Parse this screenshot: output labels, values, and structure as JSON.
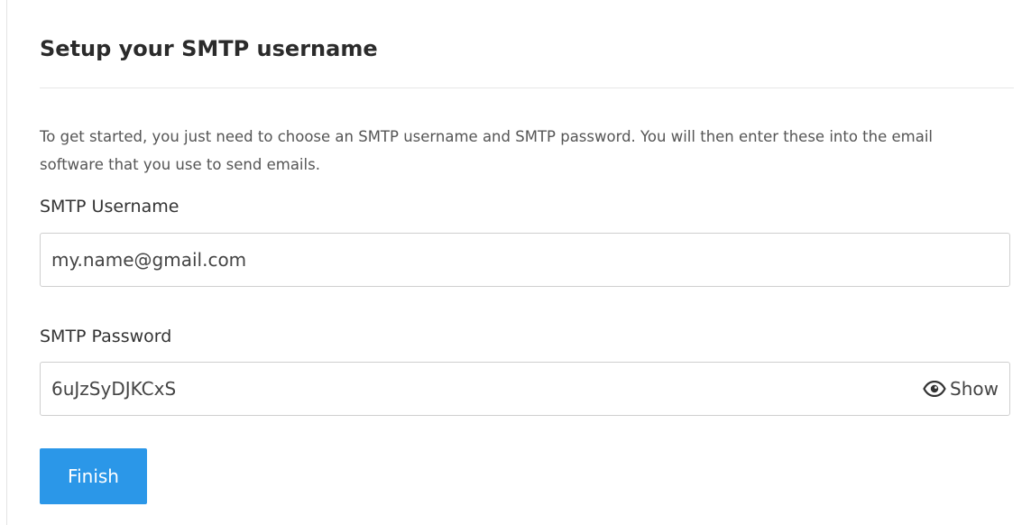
{
  "form": {
    "title": "Setup your SMTP username",
    "intro": "To get started, you just need to choose an SMTP username and SMTP password. You will then enter these into the email software that you use to send emails.",
    "username": {
      "label": "SMTP Username",
      "value": "my.name@gmail.com"
    },
    "password": {
      "label": "SMTP Password",
      "value": "6uJzSyDJKCxS",
      "toggle_label": "Show",
      "toggle_icon": "eye-icon"
    },
    "submit_label": "Finish"
  },
  "colors": {
    "accent": "#2b97e8",
    "divider": "#e6e6e6",
    "field_border": "#cfcfcf"
  }
}
